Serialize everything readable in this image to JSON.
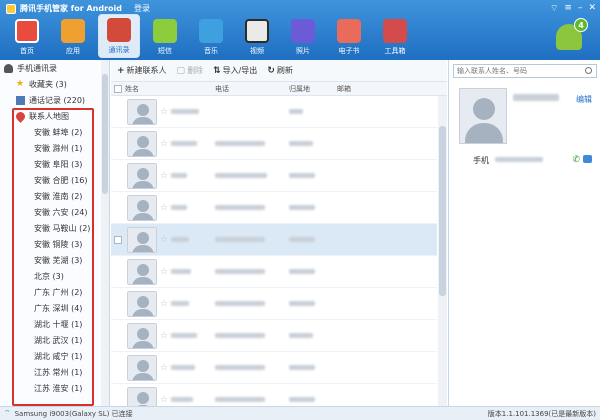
{
  "title": "腾讯手机管家 for Android",
  "login_label": "登录",
  "tabs": [
    {
      "label": "首页",
      "icon": "home-icon"
    },
    {
      "label": "应用",
      "icon": "app-icon"
    },
    {
      "label": "通讯录",
      "icon": "contacts-icon",
      "active": true
    },
    {
      "label": "短信",
      "icon": "sms-icon"
    },
    {
      "label": "音乐",
      "icon": "music-icon"
    },
    {
      "label": "视频",
      "icon": "video-icon"
    },
    {
      "label": "照片",
      "icon": "photo-icon"
    },
    {
      "label": "电子书",
      "icon": "ebook-icon"
    },
    {
      "label": "工具箱",
      "icon": "toolbox-icon"
    }
  ],
  "badge_count": "4",
  "sidebar": {
    "root_label": "手机通讯录",
    "favorites_label": "收藏夹 (3)",
    "call_log_label": "通话记录 (220)",
    "map_label": "联系人地图",
    "regions": [
      "安徽 蚌埠 (2)",
      "安徽 滁州 (1)",
      "安徽 阜阳 (3)",
      "安徽 合肥 (16)",
      "安徽 淮南 (2)",
      "安徽 六安 (24)",
      "安徽 马鞍山 (2)",
      "安徽 铜陵 (3)",
      "安徽 芜湖 (3)",
      "北京 (3)",
      "广东 广州 (2)",
      "广东 深圳 (4)",
      "湖北 十堰 (1)",
      "湖北 武汉 (1)",
      "湖北 咸宁 (1)",
      "江苏 常州 (1)",
      "江苏 淮安 (1)"
    ]
  },
  "actions": {
    "new_contact": "新建联系人",
    "delete": "删除",
    "import_export": "导入/导出",
    "refresh": "刷新"
  },
  "columns": {
    "name": "姓名",
    "phone": "电话",
    "location": "归属地",
    "email": "邮箱"
  },
  "detail": {
    "search_placeholder": "输入联系人姓名、号码",
    "edit_label": "编辑",
    "phone_label": "手机"
  },
  "status": {
    "device": "Samsung i9003(Galaxy SL) 已连接",
    "version": "版本1.1.101.1369(已是最新版本)"
  },
  "colors": {
    "accent": "#1f6fc2",
    "highlight_box": "#d9302c",
    "selected_row": "#dbe9f7"
  }
}
